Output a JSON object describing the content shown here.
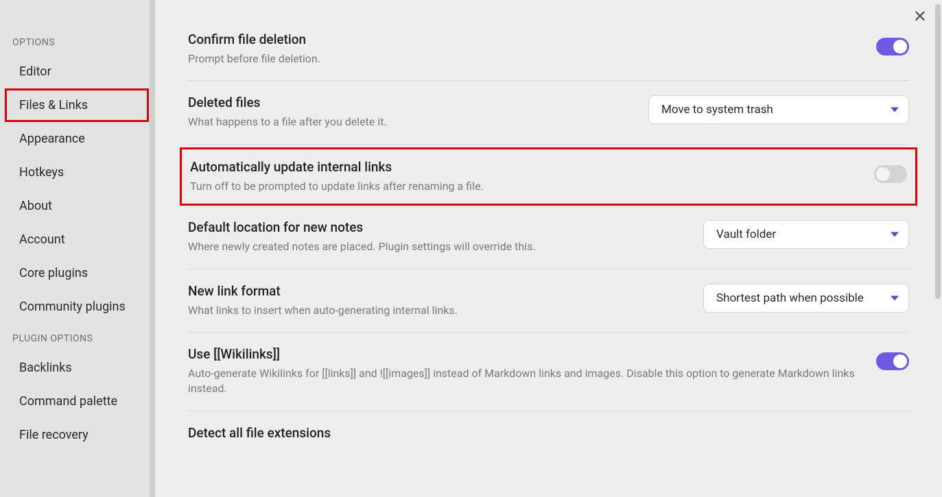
{
  "sidebar": {
    "options_header": "OPTIONS",
    "options_items": [
      "Editor",
      "Files & Links",
      "Appearance",
      "Hotkeys",
      "About",
      "Account",
      "Core plugins",
      "Community plugins"
    ],
    "plugin_header": "PLUGIN OPTIONS",
    "plugin_items": [
      "Backlinks",
      "Command palette",
      "File recovery"
    ]
  },
  "settings": {
    "confirm_delete": {
      "title": "Confirm file deletion",
      "desc": "Prompt before file deletion.",
      "toggle": true
    },
    "deleted_files": {
      "title": "Deleted files",
      "desc": "What happens to a file after you delete it.",
      "value": "Move to system trash"
    },
    "auto_update_links": {
      "title": "Automatically update internal links",
      "desc": "Turn off to be prompted to update links after renaming a file.",
      "toggle": false
    },
    "default_location": {
      "title": "Default location for new notes",
      "desc": "Where newly created notes are placed. Plugin settings will override this.",
      "value": "Vault folder"
    },
    "link_format": {
      "title": "New link format",
      "desc": "What links to insert when auto-generating internal links.",
      "value": "Shortest path when possible"
    },
    "wikilinks": {
      "title": "Use [[Wikilinks]]",
      "desc": "Auto-generate Wikilinks for [[links]] and ![[images]] instead of Markdown links and images. Disable this option to generate Markdown links instead.",
      "toggle": true
    },
    "detect_ext": {
      "title": "Detect all file extensions"
    }
  },
  "colors": {
    "accent": "#7059e2",
    "highlight": "#d30707"
  }
}
